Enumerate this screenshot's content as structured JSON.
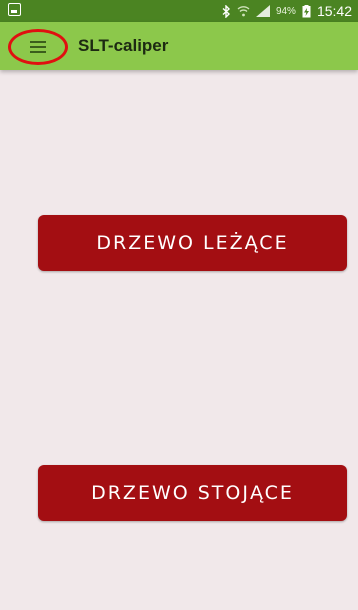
{
  "status_bar": {
    "battery_percent": "94%",
    "time": "15:42",
    "icons": [
      "image-notification-icon",
      "bluetooth-icon",
      "wifi-icon",
      "signal-icon",
      "battery-charging-icon"
    ]
  },
  "app_bar": {
    "menu_icon": "hamburger-menu-icon",
    "title": "SLT-caliper"
  },
  "main": {
    "button_lying_tree": "DRZEWO LEŻĄCE",
    "button_standing_tree": "DRZEWO STOJĄCE"
  },
  "colors": {
    "status_bar": "#4b8422",
    "app_bar": "#8cc84b",
    "background": "#f1e8ea",
    "button": "#a30e12",
    "highlight_ring": "#e01010"
  }
}
